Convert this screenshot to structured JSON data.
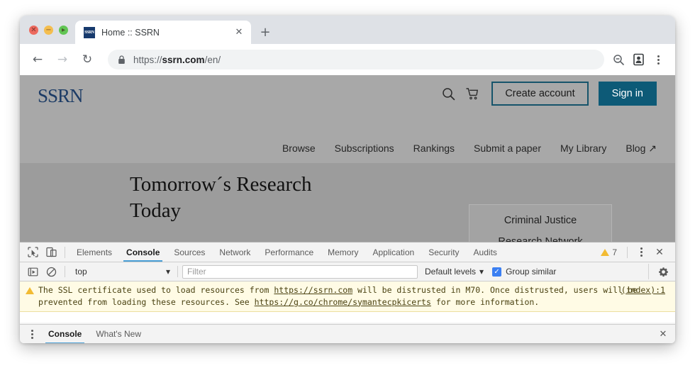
{
  "browser": {
    "traffic_lights": [
      {
        "name": "close",
        "glyph": "✕"
      },
      {
        "name": "minimize",
        "glyph": "−"
      },
      {
        "name": "maximize",
        "glyph": "▸"
      }
    ],
    "tab": {
      "favicon_text": "SSRN",
      "title": "Home :: SSRN",
      "close_glyph": "✕"
    },
    "new_tab_glyph": "+",
    "nav": {
      "back_glyph": "←",
      "forward_glyph": "→",
      "reload_glyph": "↻"
    },
    "url": {
      "scheme": "https://",
      "host": "ssrn.com",
      "path": "/en/"
    }
  },
  "site": {
    "logo": "SSRN",
    "icons": {
      "search": "search-icon",
      "cart": "cart-icon"
    },
    "create_account_label": "Create account",
    "sign_in_label": "Sign in",
    "nav_links": [
      "Browse",
      "Subscriptions",
      "Rankings",
      "Submit a paper",
      "My Library",
      "Blog ↗"
    ],
    "hero": {
      "title": "Tomorrow´s Research Today",
      "card_line1": "Criminal Justice",
      "card_line2": "Research Network"
    },
    "colors": {
      "brand_navy": "#1d3c66",
      "signin_bg": "#0d5a77",
      "create_border": "#16546b",
      "header_overlay": "#a8a8a8",
      "hero_overlay": "#9c9c9c"
    }
  },
  "devtools": {
    "tool_icons": {
      "inspect": "inspect-cursor-icon",
      "device": "device-toolbar-icon"
    },
    "tabs": [
      {
        "label": "Elements",
        "active": false
      },
      {
        "label": "Console",
        "active": true
      },
      {
        "label": "Sources",
        "active": false
      },
      {
        "label": "Network",
        "active": false
      },
      {
        "label": "Performance",
        "active": false
      },
      {
        "label": "Memory",
        "active": false
      },
      {
        "label": "Application",
        "active": false
      },
      {
        "label": "Security",
        "active": false
      },
      {
        "label": "Audits",
        "active": false
      }
    ],
    "warning_count": "7",
    "more_glyph": "⋮",
    "close_glyph": "✕",
    "console_toolbar": {
      "execute_icon": "execute-in-frame-icon",
      "clear_icon": "clear-console-icon",
      "context_value": "top",
      "context_caret": "▾",
      "filter_placeholder": "Filter",
      "levels_value": "Default levels",
      "levels_caret": "▾",
      "group_similar_label": "Group similar",
      "group_similar_checked": true,
      "check_glyph": "✓",
      "settings_icon": "gear-icon"
    },
    "console_message": {
      "level": "warning",
      "text_part1": "The SSL certificate used to load resources from ",
      "link1": "https://ssrn.com",
      "text_part2": " will be distrusted in M70. Once distrusted, users will be prevented from loading these resources. See ",
      "link2": "https://g.co/chrome/symantecpkicerts",
      "text_part3": " for more information.",
      "source": "(index):1"
    },
    "drawer_tabs": [
      {
        "label": "Console",
        "active": true
      },
      {
        "label": "What's New",
        "active": false
      }
    ]
  }
}
